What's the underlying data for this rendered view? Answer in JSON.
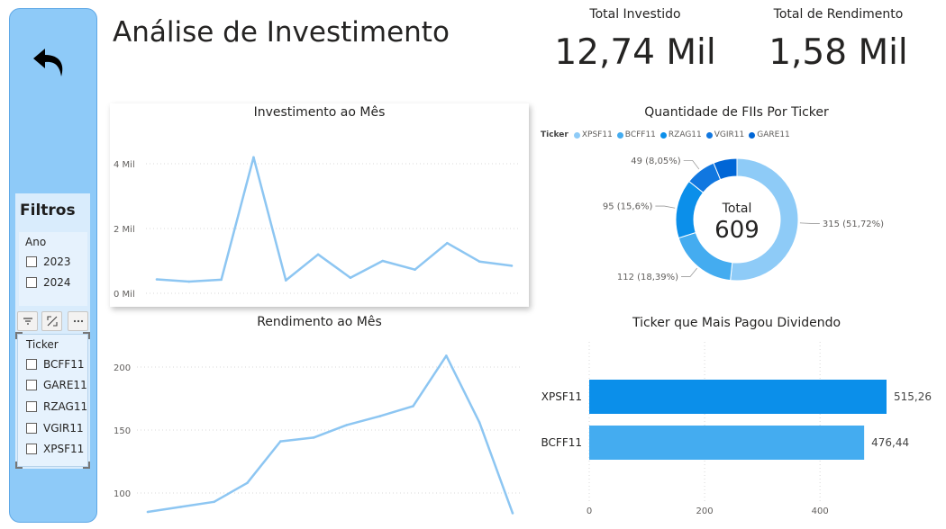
{
  "page": {
    "title": "Análise de Investimento"
  },
  "kpis": [
    {
      "label": "Total Investido",
      "value": "12,74 Mil"
    },
    {
      "label": "Total de Rendimento",
      "value": "1,58 Mil"
    }
  ],
  "colors": {
    "sidebar_bg": "#8ecaf8",
    "line": "#8dc6f2",
    "series": [
      "#8ecbf7",
      "#44acf0",
      "#0b8fea",
      "#1177e0",
      "#0066d6"
    ]
  },
  "filters": {
    "title": "Filtros",
    "ano": {
      "label": "Ano",
      "options": [
        "2023",
        "2024"
      ]
    },
    "ticker": {
      "label": "Ticker",
      "options": [
        "BCFF11",
        "GARE11",
        "RZAG11",
        "VGIR11",
        "XPSF11"
      ]
    },
    "toolbar_icons": [
      "filter-icon",
      "focus-mode-icon",
      "more-options-icon"
    ]
  },
  "back_icon": "undo-arrow-icon",
  "chart_data": [
    {
      "type": "line",
      "title": "Investimento ao Mês",
      "y_ticks": [
        "0 Mil",
        "2 Mil",
        "4 Mil"
      ],
      "ylim": [
        0,
        4000
      ],
      "values": [
        430,
        360,
        420,
        4200,
        400,
        1200,
        480,
        1000,
        730,
        1550,
        980,
        850
      ],
      "grid": true
    },
    {
      "type": "line",
      "title": "Rendimento ao Mês",
      "y_ticks": [
        "100",
        "150",
        "200"
      ],
      "ylim": [
        100,
        200
      ],
      "values": [
        85,
        89,
        93,
        108,
        141,
        144,
        154,
        161,
        169,
        209,
        156,
        84
      ],
      "grid": true
    },
    {
      "type": "pie",
      "title": "Quantidade de FIIs Por Ticker",
      "legend_title": "Ticker",
      "legend_position": "top-left",
      "center_label": "Total",
      "center_value": "609",
      "slices": [
        {
          "name": "XPSF11",
          "value": 315,
          "label": "315 (51,72%)"
        },
        {
          "name": "BCFF11",
          "value": 112,
          "label": "112 (18,39%)"
        },
        {
          "name": "RZAG11",
          "value": 95,
          "label": "95 (15,6%)"
        },
        {
          "name": "VGIR11",
          "value": 49,
          "label": "49 (8,05%)"
        },
        {
          "name": "GARE11",
          "value": 38,
          "label": ""
        }
      ]
    },
    {
      "type": "bar",
      "title": "Ticker que Mais Pagou Dividendo",
      "orientation": "horizontal",
      "categories": [
        "XPSF11",
        "BCFF11"
      ],
      "values": [
        515.26,
        476.44
      ],
      "value_labels": [
        "515,26",
        "476,44"
      ],
      "x_ticks": [
        "0",
        "200",
        "400"
      ],
      "xlim": [
        0,
        515.26
      ],
      "grid": true
    }
  ]
}
